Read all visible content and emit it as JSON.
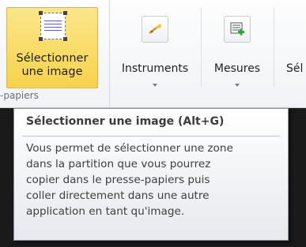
{
  "ribbon": {
    "group_label": "-papiers",
    "select_image": {
      "line1": "Sélectionner",
      "line2": "une image"
    },
    "instruments": {
      "label": "Instruments",
      "icon": "trumpet-icon"
    },
    "mesures": {
      "label": "Mesures",
      "icon": "add-measure-icon"
    },
    "sel_partial": {
      "label": "Sél",
      "icon": "selection-icon"
    }
  },
  "tooltip": {
    "title": "Sélectionner une image (Alt+G)",
    "lines": [
      "Vous permet de sélectionner une zone",
      "dans la partition que vous pourrez",
      "copier dans le presse-papiers puis",
      "coller directement dans une autre",
      "application en tant qu'image."
    ]
  },
  "colors": {
    "selected_button": "#f7d34b",
    "document_background": "#1a1a1a"
  }
}
